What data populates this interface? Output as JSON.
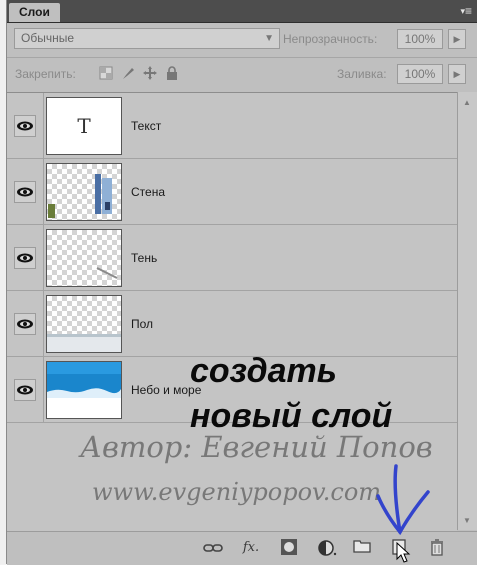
{
  "panel": {
    "tab_label": "Слои",
    "menu_icon": "≡"
  },
  "blend": {
    "value": "Обычные",
    "opacity_label": "Непрозрачность:",
    "opacity_value": "100%"
  },
  "lock": {
    "label": "Закрепить:",
    "fill_label": "Заливка:",
    "fill_value": "100%"
  },
  "layers": [
    {
      "name": "Текст",
      "thumb_text": "T"
    },
    {
      "name": "Стена"
    },
    {
      "name": "Тень"
    },
    {
      "name": "Пол"
    },
    {
      "name": "Небо и море"
    }
  ],
  "bottom_icons": [
    "link-icon",
    "fx-icon",
    "mask-icon",
    "adjustment-icon",
    "folder-icon",
    "new-layer-icon",
    "trash-icon"
  ],
  "bottom_glyphs": {
    "fx": "fx."
  },
  "annotation": {
    "line1": "создать",
    "line2": "новый слой"
  },
  "watermark": {
    "author": "Автор: Евгений Попов",
    "site": "www.evgeniypopov.com"
  },
  "colors": {
    "panel_bg": "#bfbfbf",
    "pen_stroke": "#3344cc"
  }
}
